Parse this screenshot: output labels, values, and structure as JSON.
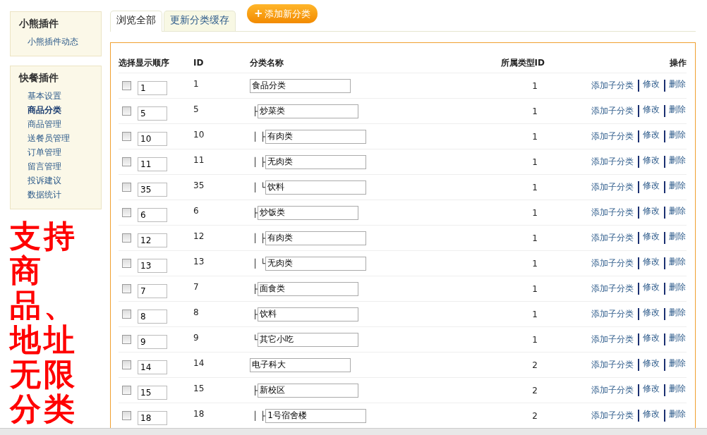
{
  "sidebar": [
    {
      "title": "小熊插件",
      "items": [
        {
          "label": "小熊插件动态",
          "selected": false
        }
      ]
    },
    {
      "title": "快餐插件",
      "items": [
        {
          "label": "基本设置",
          "selected": false
        },
        {
          "label": "商品分类",
          "selected": true
        },
        {
          "label": "商品管理",
          "selected": false
        },
        {
          "label": "送餐员管理",
          "selected": false
        },
        {
          "label": "订单管理",
          "selected": false
        },
        {
          "label": "留言管理",
          "selected": false
        },
        {
          "label": "投诉建议",
          "selected": false
        },
        {
          "label": "数据统计",
          "selected": false
        }
      ]
    }
  ],
  "annotation": "支持商品、地址无限分类",
  "tabs": [
    {
      "label": "浏览全部",
      "selected": true
    },
    {
      "label": "更新分类缓存",
      "selected": false
    }
  ],
  "add_button": {
    "icon": "+",
    "label": "添加新分类"
  },
  "table": {
    "columns": [
      "选择显示顺序",
      "ID",
      "分类名称",
      "所属类型ID",
      "操作"
    ],
    "rows": [
      {
        "checked": false,
        "order": "1",
        "id": "1",
        "prefix": "",
        "name": "食品分类",
        "type_id": "1",
        "actions": [
          "添加子分类",
          "修改",
          "删除"
        ],
        "children": [
          {
            "checked": false,
            "order": "5",
            "id": "5",
            "prefix": "├",
            "name": "炒菜类",
            "type_id": "1",
            "actions": [
              "添加子分类",
              "修改",
              "删除"
            ],
            "children": [
              {
                "checked": false,
                "order": "10",
                "id": "10",
                "prefix": "│ ├",
                "name": "有肉类",
                "type_id": "1",
                "actions": [
                  "添加子分类",
                  "修改",
                  "删除"
                ]
              },
              {
                "checked": false,
                "order": "11",
                "id": "11",
                "prefix": "│ ├",
                "name": "无肉类",
                "type_id": "1",
                "actions": [
                  "添加子分类",
                  "修改",
                  "删除"
                ]
              },
              {
                "checked": false,
                "order": "35",
                "id": "35",
                "prefix": "│ └",
                "name": "饮料",
                "type_id": "1",
                "actions": [
                  "添加子分类",
                  "修改",
                  "删除"
                ]
              }
            ]
          },
          {
            "checked": false,
            "order": "6",
            "id": "6",
            "prefix": "├",
            "name": "炒饭类",
            "type_id": "1",
            "actions": [
              "添加子分类",
              "修改",
              "删除"
            ],
            "children": [
              {
                "checked": false,
                "order": "12",
                "id": "12",
                "prefix": "│ ├",
                "name": "有肉类",
                "type_id": "1",
                "actions": [
                  "添加子分类",
                  "修改",
                  "删除"
                ]
              },
              {
                "checked": false,
                "order": "13",
                "id": "13",
                "prefix": "│ └",
                "name": "无肉类",
                "type_id": "1",
                "actions": [
                  "添加子分类",
                  "修改",
                  "删除"
                ]
              }
            ]
          },
          {
            "checked": false,
            "order": "7",
            "id": "7",
            "prefix": "├",
            "name": "面食类",
            "type_id": "1",
            "actions": [
              "添加子分类",
              "修改",
              "删除"
            ]
          },
          {
            "checked": false,
            "order": "8",
            "id": "8",
            "prefix": "├",
            "name": "饮料",
            "type_id": "1",
            "actions": [
              "添加子分类",
              "修改",
              "删除"
            ]
          },
          {
            "checked": false,
            "order": "9",
            "id": "9",
            "prefix": "└",
            "name": "其它小吃",
            "type_id": "1",
            "actions": [
              "添加子分类",
              "修改",
              "删除"
            ]
          }
        ]
      },
      {
        "checked": false,
        "order": "14",
        "id": "14",
        "prefix": "",
        "name": "电子科大",
        "type_id": "2",
        "actions": [
          "添加子分类",
          "修改",
          "删除"
        ],
        "children": [
          {
            "checked": false,
            "order": "15",
            "id": "15",
            "prefix": "├",
            "name": "新校区",
            "type_id": "2",
            "actions": [
              "添加子分类",
              "修改",
              "删除"
            ],
            "children": [
              {
                "checked": false,
                "order": "18",
                "id": "18",
                "prefix": "│ ├",
                "name": "1号宿舍楼",
                "type_id": "2",
                "actions": [
                  "添加子分类",
                  "修改",
                  "删除"
                ]
              }
            ]
          }
        ]
      }
    ]
  }
}
